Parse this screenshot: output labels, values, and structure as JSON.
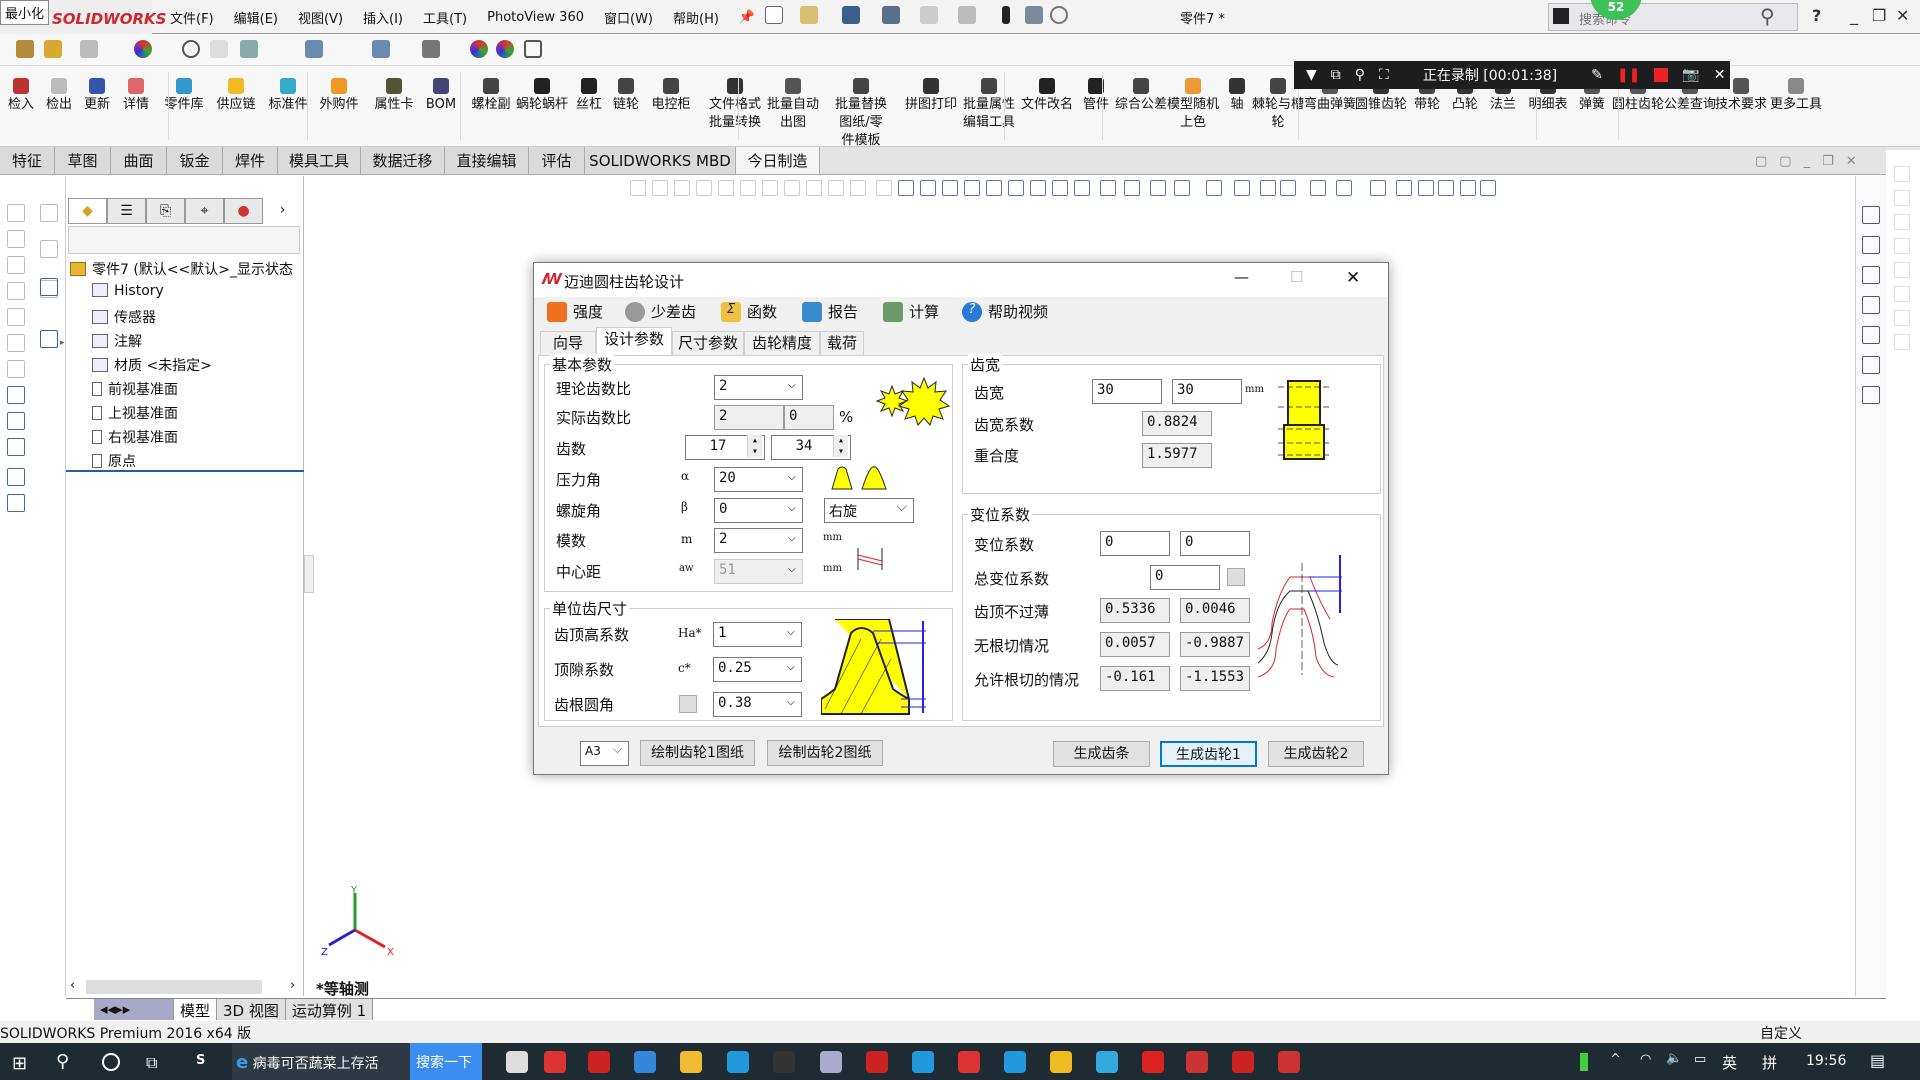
{
  "titlebar": {
    "tooltip": "最小化",
    "app_logo": "SOLIDWORKS",
    "menu": [
      "文件(F)",
      "编辑(E)",
      "视图(V)",
      "插入(I)",
      "工具(T)",
      "PhotoView 360",
      "窗口(W)",
      "帮助(H)"
    ],
    "document_title": "零件7 *",
    "search_placeholder": "搜索命令",
    "notification_count": "52",
    "help": "?"
  },
  "ribbon": {
    "items": [
      "检入",
      "检出",
      "更新",
      "详情",
      "零件库",
      "供应链",
      "标准件",
      "外购件",
      "属性卡",
      "BOM",
      "螺栓副",
      "蜗轮蜗杆",
      "丝杠",
      "链轮",
      "电控柜",
      "文件格式批量转换",
      "批量自动出图",
      "批量替换图纸/零件模板",
      "拼图打印",
      "批量属性编辑工具",
      "文件改名",
      "管件",
      "综合公差",
      "模型随机上色",
      "轴",
      "棘轮与槽轮",
      "弯曲弹簧",
      "圆锥齿轮",
      "带轮",
      "凸轮",
      "法兰",
      "明细表",
      "弹簧",
      "圆柱齿轮",
      "公差查询",
      "技术要求",
      "更多工具"
    ]
  },
  "recorder": {
    "status": "正在录制 [00:01:38]"
  },
  "command_tabs": [
    "特征",
    "草图",
    "曲面",
    "钣金",
    "焊件",
    "模具工具",
    "数据迁移",
    "直接编辑",
    "评估",
    "SOLIDWORKS MBD",
    "今日制造"
  ],
  "feature_tree": {
    "root": "零件7  (默认<<默认>_显示状态",
    "items": [
      "History",
      "传感器",
      "注解",
      "材质 <未指定>",
      "前视基准面",
      "上视基准面",
      "右视基准面",
      "原点"
    ]
  },
  "viewport": {
    "view_name": "*等轴测",
    "triad_axes": [
      "X",
      "Y",
      "Z"
    ]
  },
  "bottom_tabs": [
    "模型",
    "3D 视图",
    "运动算例 1"
  ],
  "status_bar": {
    "left": "SOLIDWORKS Premium 2016 x64 版",
    "right": "自定义"
  },
  "taskbar": {
    "browser_text": "病毒可否蔬菜上存活",
    "search_button": "搜索一下",
    "ime": "英",
    "ime2": "拼",
    "time": "19:56"
  },
  "dialog": {
    "title": "迈迪圆柱齿轮设计",
    "toolbar": [
      "强度",
      "少差齿",
      "函数",
      "报告",
      "计算",
      "帮助视频"
    ],
    "tabs": [
      "向导",
      "设计参数",
      "尺寸参数",
      "齿轮精度",
      "载荷"
    ],
    "active_tab": "设计参数",
    "basic": {
      "title": "基本参数",
      "theory_ratio": {
        "label": "理论齿数比",
        "value": "2"
      },
      "actual_ratio": {
        "label": "实际齿数比",
        "value": "2",
        "percent": "0",
        "unit": "%"
      },
      "teeth": {
        "label": "齿数",
        "z1": "17",
        "z2": "34"
      },
      "pressure_angle": {
        "label": "压力角",
        "symbol": "α",
        "value": "20"
      },
      "helix_angle": {
        "label": "螺旋角",
        "symbol": "β",
        "value": "0",
        "direction": "右旋"
      },
      "module": {
        "label": "模数",
        "symbol": "m",
        "value": "2",
        "unit": "mm"
      },
      "center_distance": {
        "label": "中心距",
        "symbol": "aw",
        "value": "51",
        "unit": "mm"
      }
    },
    "unit_tooth": {
      "title": "单位齿尺寸",
      "addendum": {
        "label": "齿顶高系数",
        "symbol": "Ha*",
        "value": "1"
      },
      "clearance": {
        "label": "顶隙系数",
        "symbol": "c*",
        "value": "0.25"
      },
      "root_fillet": {
        "label": "齿根圆角",
        "value": "0.38"
      }
    },
    "width": {
      "title": "齿宽",
      "face_width": {
        "label": "齿宽",
        "b1": "30",
        "b2": "30",
        "unit": "mm"
      },
      "width_coef": {
        "label": "齿宽系数",
        "value": "0.8824"
      },
      "contact_ratio": {
        "label": "重合度",
        "value": "1.5977"
      }
    },
    "shift": {
      "title": "变位系数",
      "shift_coef": {
        "label": "变位系数",
        "x1": "0",
        "x2": "0"
      },
      "total_shift": {
        "label": "总变位系数",
        "value": "0"
      },
      "tip_not_thin": {
        "label": "齿顶不过薄",
        "v1": "0.5336",
        "v2": "0.0046"
      },
      "no_undercut": {
        "label": "无根切情况",
        "v1": "0.0057",
        "v2": "-0.9887"
      },
      "allow_undercut": {
        "label": "允许根切的情况",
        "v1": "-0.161",
        "v2": "-1.1553"
      }
    },
    "footer": {
      "paper": "A3",
      "draw1": "绘制齿轮1图纸",
      "draw2": "绘制齿轮2图纸",
      "rack": "生成齿条",
      "gear1": "生成齿轮1",
      "gear2": "生成齿轮2"
    }
  },
  "colors": {
    "gear_yellow": "#ffff00",
    "accent_blue": "#0078d7",
    "brand_red": "#d0262e",
    "recorder_bg": "#1d1d1d"
  }
}
